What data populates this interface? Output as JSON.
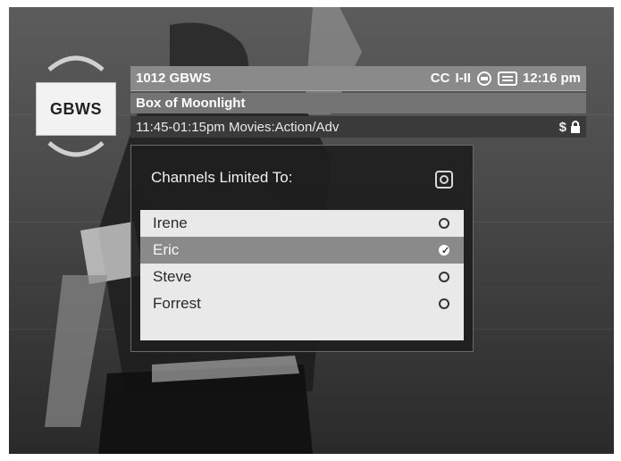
{
  "channel_logo": "GBWS",
  "banner": {
    "channel": "1012 GBWS",
    "cc": "CC",
    "rating": "I-II",
    "time": "12:16 pm",
    "program_title": "Box of Moonlight",
    "program_info": "11:45-01:15pm Movies:Action/Adv",
    "price_symbol": "$"
  },
  "dialog": {
    "title": "Channels Limited To:",
    "items": [
      {
        "label": "Irene",
        "selected": false
      },
      {
        "label": "Eric",
        "selected": true
      },
      {
        "label": "Steve",
        "selected": false
      },
      {
        "label": "Forrest",
        "selected": false
      }
    ]
  },
  "icons": [
    "up-arrow-icon",
    "down-arrow-icon",
    "closed-caption-icon",
    "guide-icon",
    "lock-icon",
    "close-icon",
    "radio-icon",
    "check-icon"
  ]
}
